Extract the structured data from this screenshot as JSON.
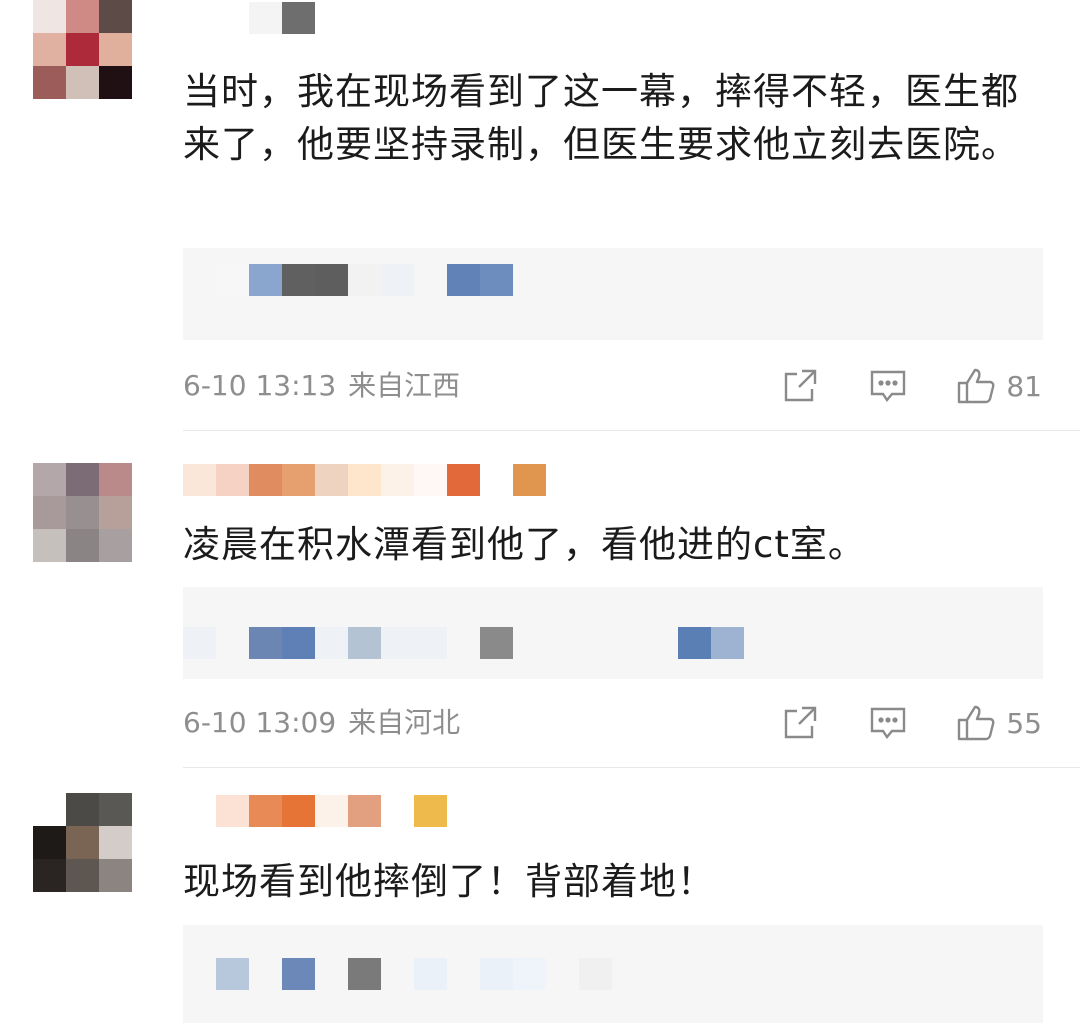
{
  "comments": [
    {
      "text": "当时，我在现场看到了这一幕，摔得不轻，医生都来了，他要坚持录制，但医生要求他立刻去医院。",
      "time": "6-10 13:13",
      "location": "来自江西",
      "likes": "81",
      "icons": {
        "share": "share-icon",
        "comment": "comment-icon",
        "like": "thumbs-up-icon"
      }
    },
    {
      "text": "凌晨在积水潭看到他了，看他进的ct室。",
      "time": "6-10 13:09",
      "location": "来自河北",
      "likes": "55",
      "icons": {
        "share": "share-icon",
        "comment": "comment-icon",
        "like": "thumbs-up-icon"
      }
    },
    {
      "text": "现场看到他摔倒了！背部着地！",
      "icons": {}
    }
  ],
  "colors": {
    "text": "#1b1b1b",
    "meta": "#8e8e8e",
    "reply_bg": "#f6f6f6",
    "divider": "#e8e8e8"
  }
}
